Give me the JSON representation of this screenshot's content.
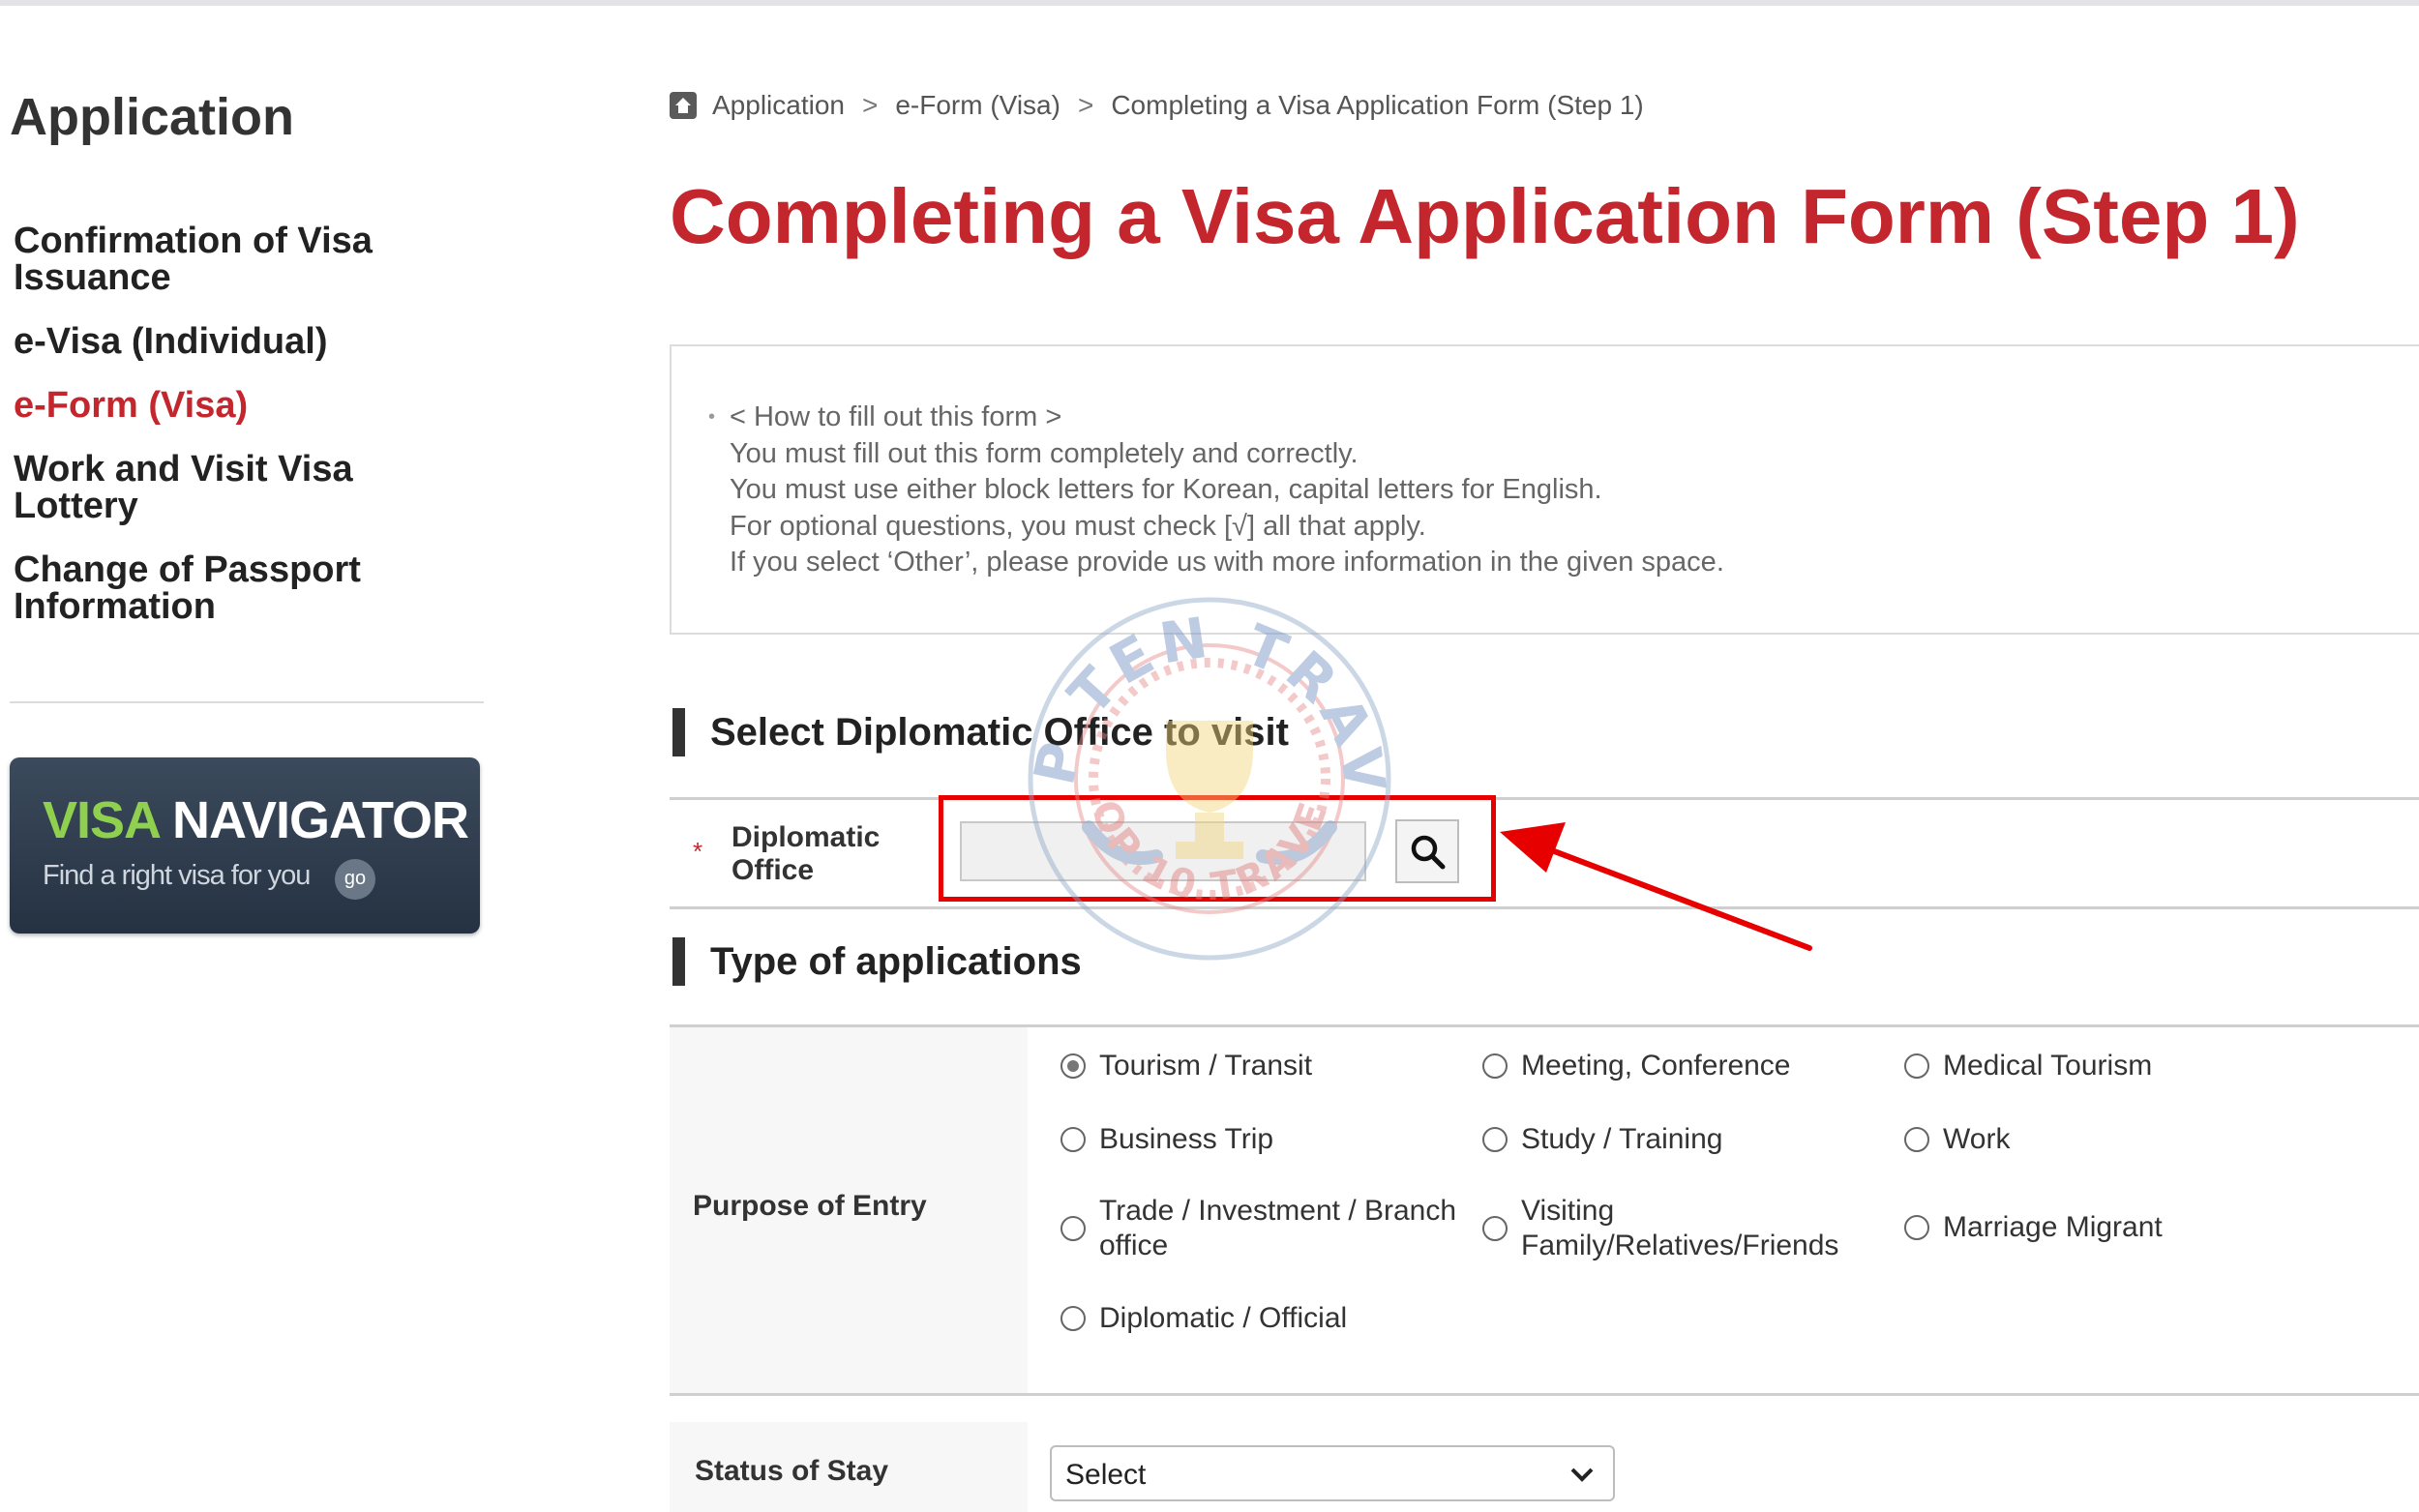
{
  "sidebar": {
    "title": "Application",
    "items": [
      {
        "label": "Confirmation of Visa Issuance"
      },
      {
        "label": "e-Visa (Individual)"
      },
      {
        "label": "e-Form (Visa)"
      },
      {
        "label": "Work and Visit Visa Lottery"
      },
      {
        "label": "Change of Passport Information"
      }
    ],
    "banner": {
      "title_green": "VISA",
      "title_white": "NAVIGATOR",
      "subtitle": "Find a right visa for you",
      "go_label": "go"
    }
  },
  "breadcrumb": {
    "items": [
      "Application",
      "e-Form (Visa)",
      "Completing a Visa Application Form (Step 1)"
    ],
    "separator": ">"
  },
  "page_title": "Completing a Visa Application Form (Step 1)",
  "info": {
    "lines": [
      "< How to fill out this form >",
      "You must fill out this form completely and correctly.",
      "You must use either block letters for Korean, capital letters for English.",
      "For optional questions, you must check [√] all that apply.",
      "If you select ‘Other’, please provide us with more information in the given space."
    ]
  },
  "diplomatic": {
    "section_title": "Select Diplomatic Office to visit",
    "required_mark": "*",
    "label_line1": "Diplomatic",
    "label_line2": "Office",
    "value": ""
  },
  "types": {
    "section_title": "Type of applications",
    "purpose_label": "Purpose of Entry",
    "options": [
      {
        "label": "Tourism / Transit",
        "checked": true
      },
      {
        "label": "Meeting, Conference",
        "checked": false
      },
      {
        "label": "Medical Tourism",
        "checked": false
      },
      {
        "label": "Business Trip",
        "checked": false
      },
      {
        "label": "Study / Training",
        "checked": false
      },
      {
        "label": "Work",
        "checked": false
      },
      {
        "label": "Trade / Investment / Branch office",
        "line1": "Trade / Investment / Branch",
        "line2": "office",
        "checked": false
      },
      {
        "label": "Visiting Family/Relatives/Friends",
        "line1": "Visiting",
        "line2": "Family/Relatives/Friends",
        "checked": false
      },
      {
        "label": "Marriage Migrant",
        "checked": false
      },
      {
        "label": "Diplomatic / Official",
        "checked": false
      }
    ]
  },
  "status": {
    "label": "Status of Stay",
    "selected": "Select"
  },
  "watermark": {
    "top_text": "TOP TEN TRAVEL",
    "bottom_text": "TOP 10 TRAVEL"
  },
  "colors": {
    "accent_red": "#c4262e",
    "highlight_red": "#e60000",
    "banner_bg": "#2c3949",
    "banner_green": "#8fd14f"
  }
}
